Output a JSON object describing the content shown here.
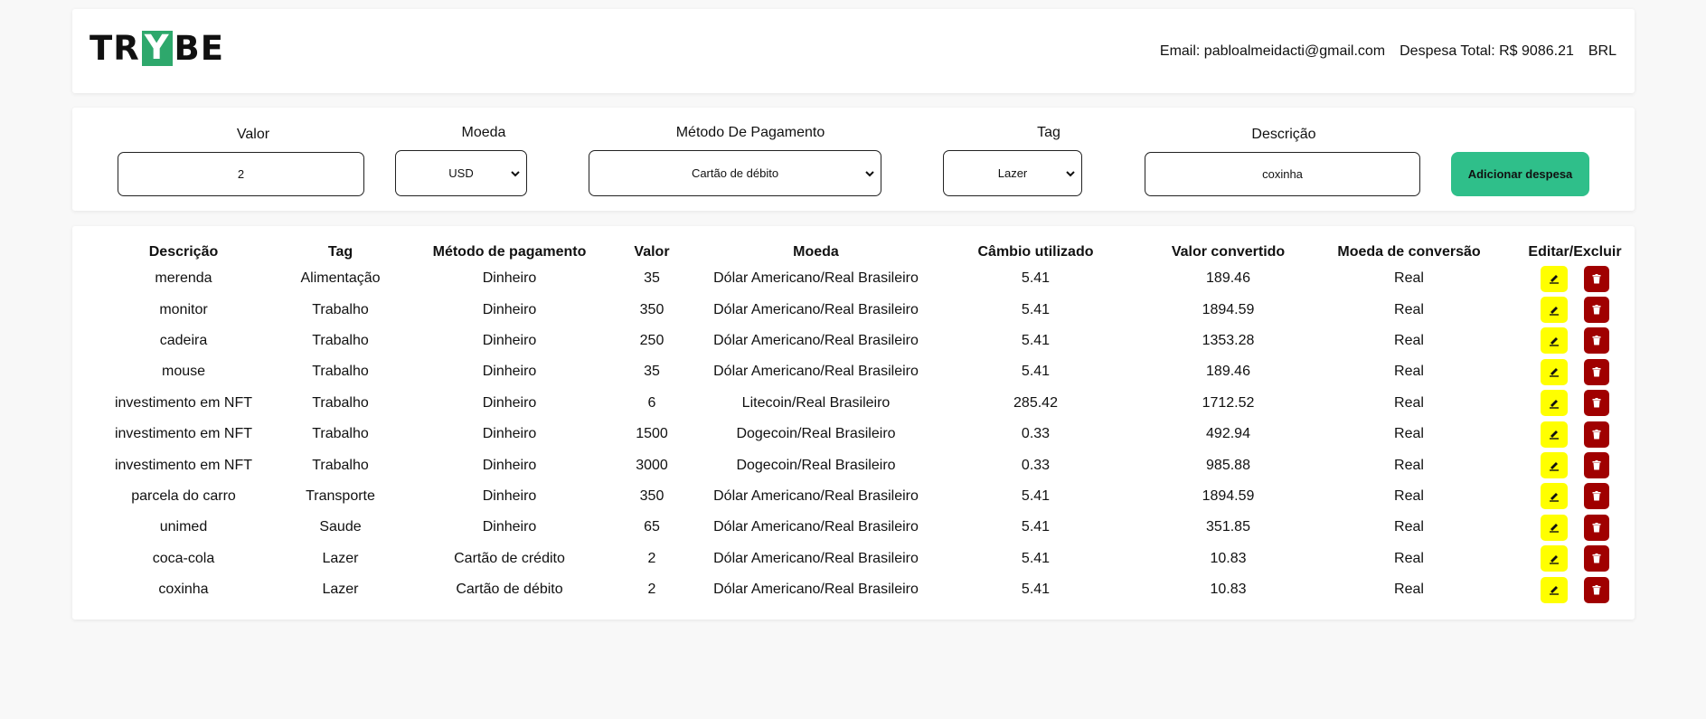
{
  "header": {
    "logo_left": "TR",
    "logo_mark": "Y",
    "logo_right": "BE",
    "email_label": "Email:",
    "email": "pabloalmeidacti@gmail.com",
    "total_label": "Despesa Total: R$",
    "total_value": "9086.21",
    "currency": "BRL"
  },
  "form": {
    "valor_label": "Valor",
    "valor_value": "2",
    "moeda_label": "Moeda",
    "moeda_value": "USD",
    "metodo_label": "Método De Pagamento",
    "metodo_value": "Cartão de débito",
    "tag_label": "Tag",
    "tag_value": "Lazer",
    "descricao_label": "Descrição",
    "descricao_value": "coxinha",
    "add_button": "Adicionar despesa"
  },
  "table": {
    "headers": [
      "Descrição",
      "Tag",
      "Método de pagamento",
      "Valor",
      "Moeda",
      "Câmbio utilizado",
      "Valor convertido",
      "Moeda de conversão",
      "Editar/Excluir"
    ],
    "rows": [
      [
        "merenda",
        "Alimentação",
        "Dinheiro",
        "35",
        "Dólar Americano/Real Brasileiro",
        "5.41",
        "189.46",
        "Real"
      ],
      [
        "monitor",
        "Trabalho",
        "Dinheiro",
        "350",
        "Dólar Americano/Real Brasileiro",
        "5.41",
        "1894.59",
        "Real"
      ],
      [
        "cadeira",
        "Trabalho",
        "Dinheiro",
        "250",
        "Dólar Americano/Real Brasileiro",
        "5.41",
        "1353.28",
        "Real"
      ],
      [
        "mouse",
        "Trabalho",
        "Dinheiro",
        "35",
        "Dólar Americano/Real Brasileiro",
        "5.41",
        "189.46",
        "Real"
      ],
      [
        "investimento em NFT",
        "Trabalho",
        "Dinheiro",
        "6",
        "Litecoin/Real Brasileiro",
        "285.42",
        "1712.52",
        "Real"
      ],
      [
        "investimento em NFT",
        "Trabalho",
        "Dinheiro",
        "1500",
        "Dogecoin/Real Brasileiro",
        "0.33",
        "492.94",
        "Real"
      ],
      [
        "investimento em NFT",
        "Trabalho",
        "Dinheiro",
        "3000",
        "Dogecoin/Real Brasileiro",
        "0.33",
        "985.88",
        "Real"
      ],
      [
        "parcela do carro",
        "Transporte",
        "Dinheiro",
        "350",
        "Dólar Americano/Real Brasileiro",
        "5.41",
        "1894.59",
        "Real"
      ],
      [
        "unimed",
        "Saude",
        "Dinheiro",
        "65",
        "Dólar Americano/Real Brasileiro",
        "5.41",
        "351.85",
        "Real"
      ],
      [
        "coca-cola",
        "Lazer",
        "Cartão de crédito",
        "2",
        "Dólar Americano/Real Brasileiro",
        "5.41",
        "10.83",
        "Real"
      ],
      [
        "coxinha",
        "Lazer",
        "Cartão de débito",
        "2",
        "Dólar Americano/Real Brasileiro",
        "5.41",
        "10.83",
        "Real"
      ]
    ]
  },
  "colors": {
    "edit_button": "#ffff00",
    "delete_button": "#a00000",
    "add_button": "#2fbf8a",
    "logo_mark": "#2ea86c"
  },
  "icons": {
    "edit": "pencil-icon",
    "delete": "trash-icon",
    "select": "chevron-down-icon"
  }
}
